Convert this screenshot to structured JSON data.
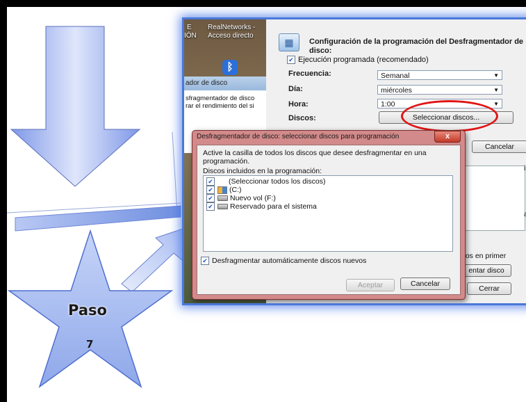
{
  "slide": {
    "step_label": "Paso",
    "step_number": "7",
    "accent_color": "#4a78d8",
    "star_fill": "#9db4ef"
  },
  "screenshot": {
    "desktop": {
      "icon_1": "E",
      "icon_1_sub": "IÓN",
      "icon_2": "RealNetworks -",
      "icon_2_sub": "Acceso directo",
      "bluetooth_icon": "bluetooth-icon"
    },
    "left_window": {
      "title": "ador de disco",
      "text_line_1": "sfragmentador de disco",
      "text_line_2": "rar el rendimiento del si"
    },
    "config": {
      "title": "Configuración de la programación del Desfragmentador de disco:",
      "scheduled_label": "Ejecución programada (recomendado)",
      "frequency_label": "Frecuencia:",
      "frequency_value": "Semanal",
      "day_label": "Día:",
      "day_value": "miércoles",
      "hour_label": "Hora:",
      "hour_value": "1:00",
      "disks_label": "Discos:",
      "select_disks_button": "Seleccionar discos...",
      "cancel_button": "Cancelar"
    },
    "right_partial": {
      "text_is": "is",
      "text_an": "an",
      "text_first": "rlos en primer",
      "button_analyze": "entar disco",
      "button_close": "Cerrar"
    },
    "dialog": {
      "title": "Desfragmentador de disco: seleccionar discos para programación",
      "close_label": "x",
      "instructions": "Active la casilla de todos los discos que desee desfragmentar en una programación.",
      "list_label": "Discos incluidos en la programación:",
      "disks": [
        {
          "label": "(Seleccionar todos los discos)",
          "checked": true,
          "icon": "none"
        },
        {
          "label": "(C:)",
          "checked": true,
          "icon": "system-drive-icon"
        },
        {
          "label": "Nuevo vol (F:)",
          "checked": true,
          "icon": "drive-icon"
        },
        {
          "label": "Reservado para el sistema",
          "checked": true,
          "icon": "drive-icon"
        }
      ],
      "auto_new": "Desfragmentar automáticamente discos nuevos",
      "accept_button": "Aceptar",
      "cancel_button": "Cancelar"
    }
  }
}
